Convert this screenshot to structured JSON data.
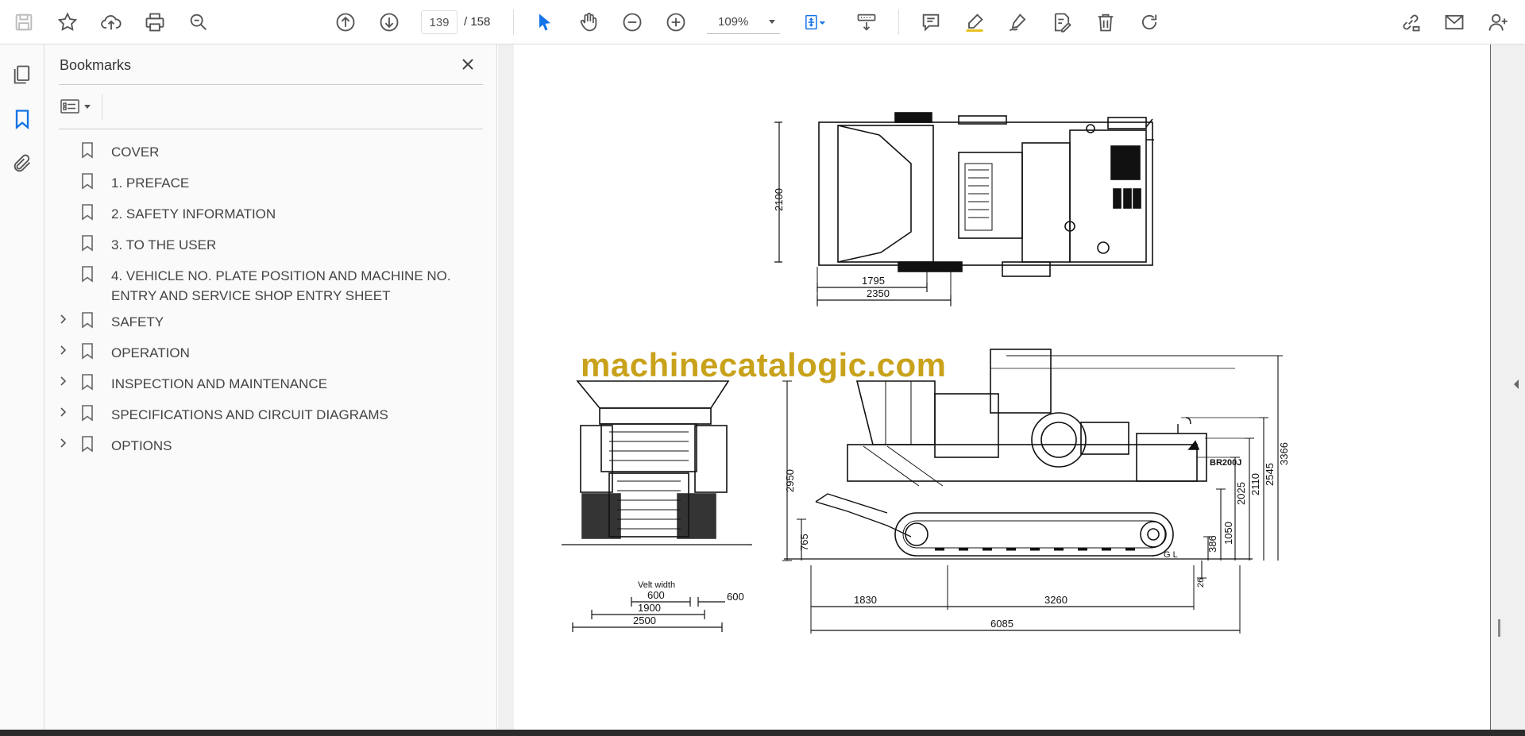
{
  "toolbar": {
    "current_page": "139",
    "total_pages": "/ 158",
    "zoom": "109%"
  },
  "bookmarks_panel": {
    "title": "Bookmarks",
    "items": [
      {
        "label": "COVER",
        "expandable": false
      },
      {
        "label": "1. PREFACE",
        "expandable": false
      },
      {
        "label": "2. SAFETY INFORMATION",
        "expandable": false
      },
      {
        "label": "3. TO THE USER",
        "expandable": false
      },
      {
        "label": "4. VEHICLE NO. PLATE POSITION AND MACHINE NO. ENTRY AND SERVICE SHOP ENTRY SHEET",
        "expandable": false
      },
      {
        "label": "SAFETY",
        "expandable": true
      },
      {
        "label": "OPERATION",
        "expandable": true
      },
      {
        "label": "INSPECTION AND MAINTENANCE",
        "expandable": true
      },
      {
        "label": "SPECIFICATIONS AND CIRCUIT DIAGRAMS",
        "expandable": true
      },
      {
        "label": "OPTIONS",
        "expandable": true
      }
    ]
  },
  "document": {
    "watermark": "machinecatalogic.com",
    "model_plate": "BR200J",
    "ground_line_label": "G L",
    "belt_label": "Velt width",
    "dimensions": {
      "top_view": [
        "2100",
        "1795",
        "2350"
      ],
      "front_view": [
        "600",
        "1900",
        "2500",
        "600"
      ],
      "side_view": [
        "2950",
        "765",
        "1830",
        "3260",
        "6085",
        "1050",
        "2025",
        "2110",
        "2545",
        "3366",
        "386",
        "26"
      ]
    }
  },
  "colors": {
    "accent_blue": "#1473e6",
    "watermark": "#c9a21c"
  }
}
